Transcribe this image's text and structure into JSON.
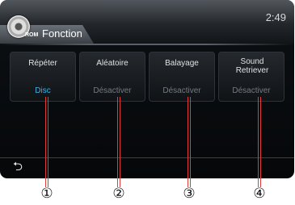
{
  "header": {
    "source_badge": "ROM",
    "title": "Fonction",
    "clock": "2:49"
  },
  "buttons": [
    {
      "label": "Répéter",
      "value": "Disc",
      "active": true
    },
    {
      "label": "Aléatoire",
      "value": "Désactiver",
      "active": false
    },
    {
      "label": "Balayage",
      "value": "Désactiver",
      "active": false
    },
    {
      "label": "Sound Retriever",
      "value": "Désactiver",
      "active": false
    }
  ],
  "back_icon": "back-arrow-icon",
  "callouts": [
    "①",
    "②",
    "③",
    "④"
  ],
  "colors": {
    "active_value": "#3fb3ea",
    "inactive_value": "#737b82",
    "callout_line": "#e23b3b"
  }
}
